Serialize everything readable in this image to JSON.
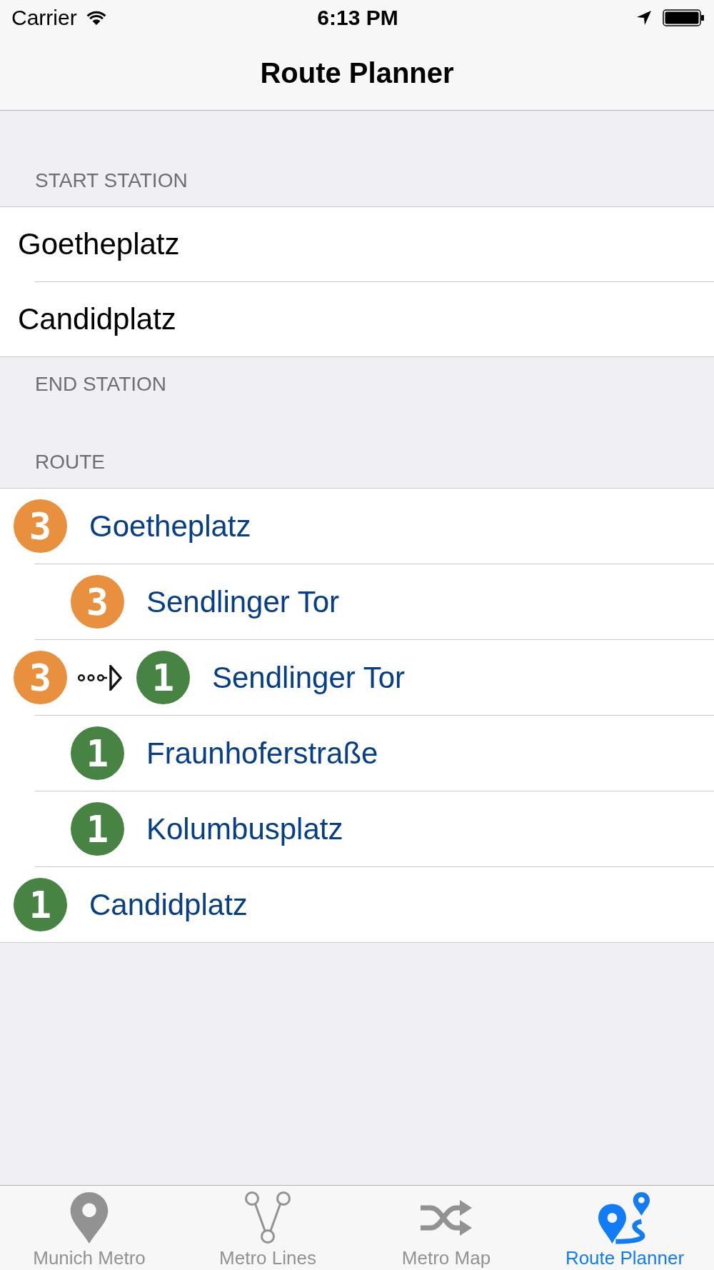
{
  "status_bar": {
    "carrier": "Carrier",
    "time": "6:13 PM"
  },
  "navigation_bar": {
    "title": "Route Planner"
  },
  "start_station": {
    "header": "START STATION",
    "options": [
      "Goetheplatz",
      "Candidplatz"
    ]
  },
  "end_station": {
    "header": "END STATION"
  },
  "route": {
    "header": "ROUTE",
    "stops": [
      {
        "kind": "terminal",
        "lines": [
          {
            "number": "3",
            "color": "#e8903d"
          }
        ],
        "name": "Goetheplatz"
      },
      {
        "kind": "stop",
        "lines": [
          {
            "number": "3",
            "color": "#e8903d"
          }
        ],
        "name": "Sendlinger Tor"
      },
      {
        "kind": "transfer",
        "lines": [
          {
            "number": "3",
            "color": "#e8903d"
          },
          {
            "number": "1",
            "color": "#478443"
          }
        ],
        "name": "Sendlinger Tor"
      },
      {
        "kind": "stop",
        "lines": [
          {
            "number": "1",
            "color": "#478443"
          }
        ],
        "name": "Fraunhoferstraße"
      },
      {
        "kind": "stop",
        "lines": [
          {
            "number": "1",
            "color": "#478443"
          }
        ],
        "name": "Kolumbusplatz"
      },
      {
        "kind": "terminal",
        "lines": [
          {
            "number": "1",
            "color": "#478443"
          }
        ],
        "name": "Candidplatz"
      }
    ]
  },
  "tab_bar": {
    "tabs": [
      {
        "label": "Munich Metro",
        "selected": false
      },
      {
        "label": "Metro Lines",
        "selected": false
      },
      {
        "label": "Metro Map",
        "selected": false
      },
      {
        "label": "Route Planner",
        "selected": true
      }
    ]
  }
}
